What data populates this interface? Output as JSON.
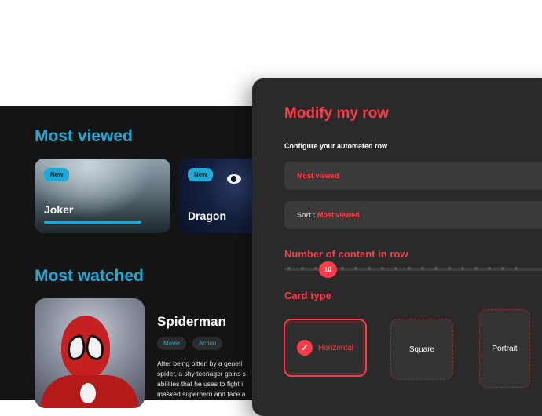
{
  "rows": {
    "most_viewed": {
      "title": "Most viewed",
      "cards": [
        {
          "badge": "New",
          "title": "Joker",
          "progress": 0.8
        },
        {
          "badge": "New",
          "title": "Dragon"
        }
      ]
    },
    "most_watched": {
      "title": "Most watched",
      "movie": {
        "title": "Spiderman",
        "genres": [
          "Movie",
          "Action"
        ],
        "description": "After being bitten by a geneti\nspider, a shy teenager gains s\nabilities that he uses to fight i\nmasked superhero and face a"
      }
    }
  },
  "modal": {
    "title": "Modify my row",
    "subtitle": "Configure your automated row",
    "row_field_value": "Most viewed",
    "sort_label": "Sort :",
    "sort_value": "Most viewed",
    "content_count_label": "Number of content in row",
    "content_count_value": "10",
    "card_type_label": "Card type",
    "card_types": [
      {
        "label": "Horizontal",
        "selected": true
      },
      {
        "label": "Square",
        "selected": false
      },
      {
        "label": "Portrait",
        "selected": false
      }
    ],
    "check_icon": "✓"
  },
  "colors": {
    "accent_red": "#ff3b47",
    "accent_blue": "#1fa9d6",
    "background_dark": "#141414",
    "modal_bg": "#2a2a2a"
  }
}
